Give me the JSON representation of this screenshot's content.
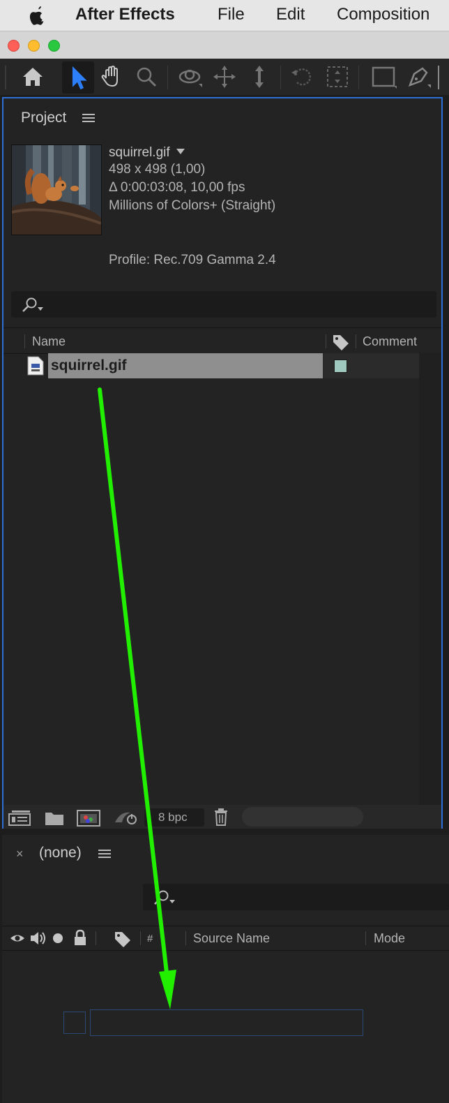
{
  "menubar": {
    "app_name": "After Effects",
    "items": [
      "File",
      "Edit",
      "Composition"
    ]
  },
  "toolbar": {
    "tools": [
      "home-icon",
      "selection-tool-icon",
      "hand-tool-icon",
      "zoom-tool-icon",
      "orbit-camera-icon",
      "pan-camera-icon",
      "dolly-camera-icon",
      "rotation-tool-icon",
      "pan-behind-icon",
      "rectangle-tool-icon",
      "pen-tool-icon"
    ],
    "active_tool": "selection-tool-icon",
    "accent": "#2d6fd6"
  },
  "project": {
    "title": "Project",
    "footage": {
      "name": "squirrel.gif",
      "dimensions": "498 x 498 (1,00)",
      "duration": "Δ 0:00:03:08, 10,00 fps",
      "colors": "Millions of Colors+ (Straight)",
      "profile": "Profile: Rec.709 Gamma 2.4"
    },
    "columns": {
      "name": "Name",
      "comment": "Comment"
    },
    "items": [
      {
        "name": "squirrel.gif",
        "label_color": "#9fc9bf"
      }
    ],
    "bit_depth": "8 bpc"
  },
  "timeline": {
    "close": "×",
    "title": "(none)",
    "columns": {
      "number": "#",
      "source_name": "Source Name",
      "mode": "Mode"
    }
  },
  "annotation": {
    "arrow_color": "#22ee00"
  }
}
